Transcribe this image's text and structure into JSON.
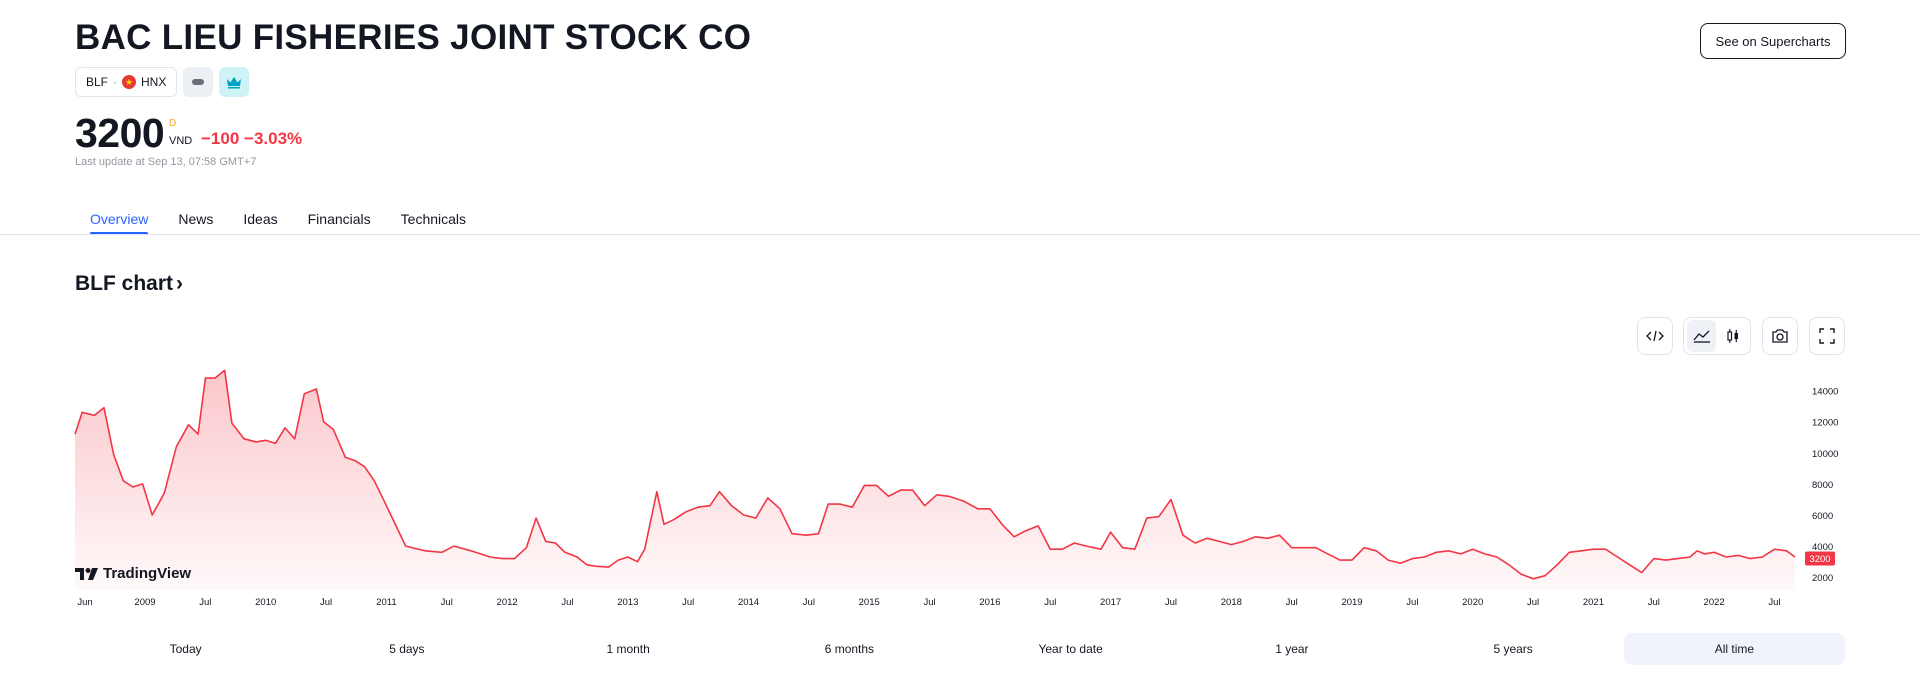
{
  "header": {
    "company_name": "BAC LIEU FISHERIES JOINT STOCK CO",
    "see_button": "See on Supercharts",
    "ticker": "BLF",
    "separator": "·",
    "exchange": "HNX",
    "flag_star": "★"
  },
  "quote": {
    "price": "3200",
    "marker": "D",
    "currency": "VND",
    "change": "−100 −3.03%",
    "last_update": "Last update at Sep 13, 07:58 GMT+7"
  },
  "tabs": [
    "Overview",
    "News",
    "Ideas",
    "Financials",
    "Technicals"
  ],
  "chart_section": {
    "heading": "BLF chart",
    "chevron": "›",
    "logo_text": "TradingView"
  },
  "ranges": [
    "Today",
    "5 days",
    "1 month",
    "6 months",
    "Year to date",
    "1 year",
    "5 years",
    "All time"
  ],
  "active_range": "All time",
  "colors": {
    "line": "#f23645",
    "accent": "#2962ff",
    "price_tag": "#f23645"
  },
  "icons": [
    "embed-code-icon",
    "area-chart-icon",
    "candles-icon",
    "camera-icon",
    "fullscreen-icon",
    "tradingview-logo-icon",
    "crown-icon",
    "flag-vn-icon"
  ],
  "chart_data": {
    "type": "area",
    "x_tick_labels": [
      "Jun",
      "2009",
      "Jul",
      "2010",
      "Jul",
      "2011",
      "Jul",
      "2012",
      "Jul",
      "2013",
      "Jul",
      "2014",
      "Jul",
      "2015",
      "Jul",
      "2016",
      "Jul",
      "2017",
      "Jul",
      "2018",
      "Jul",
      "2019",
      "Jul",
      "2020",
      "Jul",
      "2021",
      "Jul",
      "2022",
      "Jul"
    ],
    "y_ticks": [
      2000,
      4000,
      6000,
      8000,
      10000,
      12000,
      14000
    ],
    "ylim": [
      1500,
      15000
    ],
    "last_value_label": "3200",
    "x_range": [
      2008.42,
      2022.67
    ],
    "x": [
      2008.42,
      2008.48,
      2008.58,
      2008.66,
      2008.74,
      2008.82,
      2008.9,
      2008.98,
      2009.06,
      2009.16,
      2009.26,
      2009.36,
      2009.44,
      2009.5,
      2009.58,
      2009.66,
      2009.72,
      2009.82,
      2009.92,
      2010.0,
      2010.08,
      2010.16,
      2010.24,
      2010.32,
      2010.42,
      2010.48,
      2010.56,
      2010.66,
      2010.74,
      2010.82,
      2010.9,
      2011.0,
      2011.16,
      2011.32,
      2011.46,
      2011.56,
      2011.7,
      2011.86,
      2011.96,
      2012.06,
      2012.16,
      2012.24,
      2012.32,
      2012.4,
      2012.48,
      2012.58,
      2012.66,
      2012.74,
      2012.84,
      2012.92,
      2013.0,
      2013.08,
      2013.14,
      2013.24,
      2013.3,
      2013.38,
      2013.48,
      2013.58,
      2013.68,
      2013.76,
      2013.86,
      2013.96,
      2014.06,
      2014.16,
      2014.26,
      2014.36,
      2014.48,
      2014.58,
      2014.66,
      2014.76,
      2014.86,
      2014.96,
      2015.06,
      2015.16,
      2015.26,
      2015.36,
      2015.46,
      2015.56,
      2015.66,
      2015.78,
      2015.9,
      2016.0,
      2016.1,
      2016.2,
      2016.3,
      2016.4,
      2016.5,
      2016.6,
      2016.7,
      2016.8,
      2016.92,
      2017.0,
      2017.1,
      2017.2,
      2017.3,
      2017.4,
      2017.5,
      2017.6,
      2017.7,
      2017.8,
      2017.9,
      2018.0,
      2018.1,
      2018.2,
      2018.3,
      2018.4,
      2018.5,
      2018.6,
      2018.7,
      2018.8,
      2018.9,
      2019.0,
      2019.1,
      2019.2,
      2019.3,
      2019.4,
      2019.5,
      2019.6,
      2019.7,
      2019.8,
      2019.9,
      2020.0,
      2020.1,
      2020.2,
      2020.3,
      2020.4,
      2020.5,
      2020.6,
      2020.7,
      2020.8,
      2020.9,
      2021.0,
      2021.1,
      2021.2,
      2021.3,
      2021.4,
      2021.5,
      2021.6,
      2021.7,
      2021.8,
      2021.86,
      2021.92,
      2022.0,
      2022.1,
      2022.2,
      2022.3,
      2022.4,
      2022.5,
      2022.6,
      2022.67
    ],
    "y": [
      11200,
      12600,
      12400,
      12900,
      9900,
      8200,
      7800,
      8000,
      6000,
      7400,
      10400,
      11800,
      11200,
      14800,
      14800,
      15300,
      11900,
      10900,
      10700,
      10800,
      10600,
      11600,
      10900,
      13800,
      14100,
      12000,
      11500,
      9700,
      9500,
      9100,
      8200,
      6600,
      4000,
      3700,
      3600,
      4000,
      3700,
      3300,
      3200,
      3200,
      3900,
      5800,
      4300,
      4200,
      3600,
      3300,
      2800,
      2700,
      2650,
      3100,
      3300,
      3000,
      3800,
      7500,
      5400,
      5700,
      6200,
      6500,
      6600,
      7500,
      6600,
      6000,
      5800,
      7100,
      6400,
      4800,
      4700,
      4800,
      6700,
      6700,
      6500,
      7900,
      7900,
      7200,
      7600,
      7600,
      6600,
      7300,
      7200,
      6900,
      6400,
      6400,
      5400,
      4600,
      5000,
      5300,
      3800,
      3800,
      4200,
      4000,
      3800,
      4900,
      3900,
      3800,
      5800,
      5900,
      7000,
      4700,
      4200,
      4500,
      4300,
      4100,
      4300,
      4600,
      4500,
      4700,
      3900,
      3900,
      3900,
      3500,
      3100,
      3100,
      3900,
      3700,
      3100,
      2900,
      3200,
      3300,
      3600,
      3700,
      3500,
      3800,
      3500,
      3300,
      2800,
      2200,
      1900,
      2100,
      2800,
      3600,
      3700,
      3800,
      3800,
      3300,
      2800,
      2300,
      3200,
      3100,
      3200,
      3300,
      3700,
      3500,
      3600,
      3300,
      3400,
      3200,
      3300,
      3800,
      3700,
      3300,
      3100,
      3000,
      3200,
      4200,
      5000,
      7500,
      6000,
      5000,
      5200,
      4700,
      4000,
      3600,
      3300,
      3200
    ]
  }
}
